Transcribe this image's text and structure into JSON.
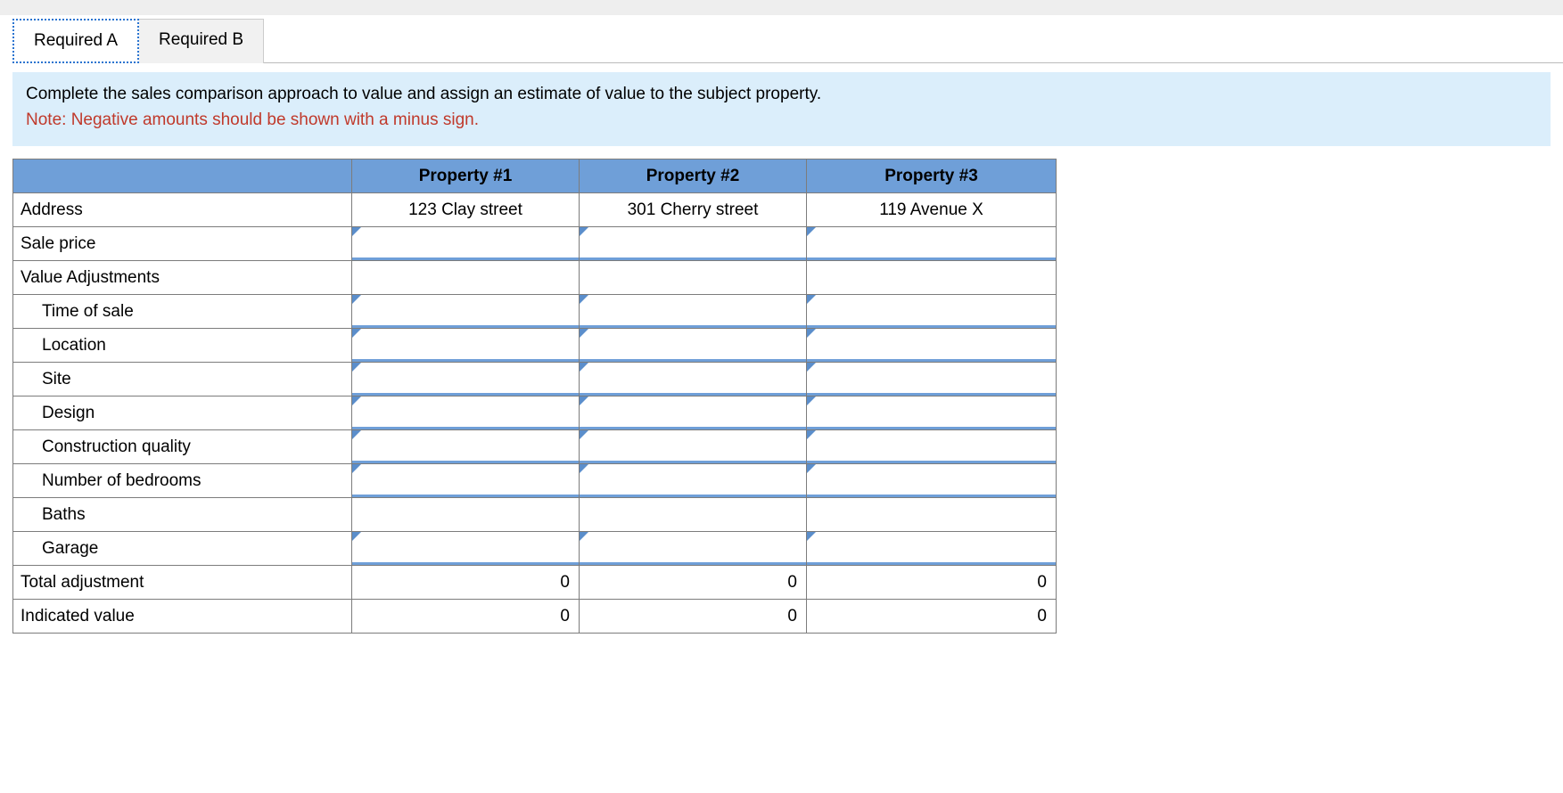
{
  "tabs": {
    "a": "Required A",
    "b": "Required B"
  },
  "instructions": {
    "line1": "Complete the sales comparison approach to value and assign an estimate of value to the subject property.",
    "line2": "Note: Negative amounts should be shown with a minus sign."
  },
  "headers": {
    "blank": "",
    "p1": "Property #1",
    "p2": "Property #2",
    "p3": "Property #3"
  },
  "rows": {
    "address": {
      "label": "Address",
      "p1": "123 Clay street",
      "p2": "301 Cherry street",
      "p3": "119 Avenue X"
    },
    "sale_price": {
      "label": "Sale price"
    },
    "value_adjustments": {
      "label": "Value Adjustments"
    },
    "time_of_sale": {
      "label": "Time of sale"
    },
    "location": {
      "label": "Location"
    },
    "site": {
      "label": "Site"
    },
    "design": {
      "label": "Design"
    },
    "construction_quality": {
      "label": "Construction quality"
    },
    "bedrooms": {
      "label": "Number of bedrooms"
    },
    "baths": {
      "label": "Baths"
    },
    "garage": {
      "label": "Garage"
    },
    "total_adjustment": {
      "label": "Total adjustment",
      "p1": "0",
      "p2": "0",
      "p3": "0"
    },
    "indicated_value": {
      "label": "Indicated value",
      "p1": "0",
      "p2": "0",
      "p3": "0"
    }
  }
}
